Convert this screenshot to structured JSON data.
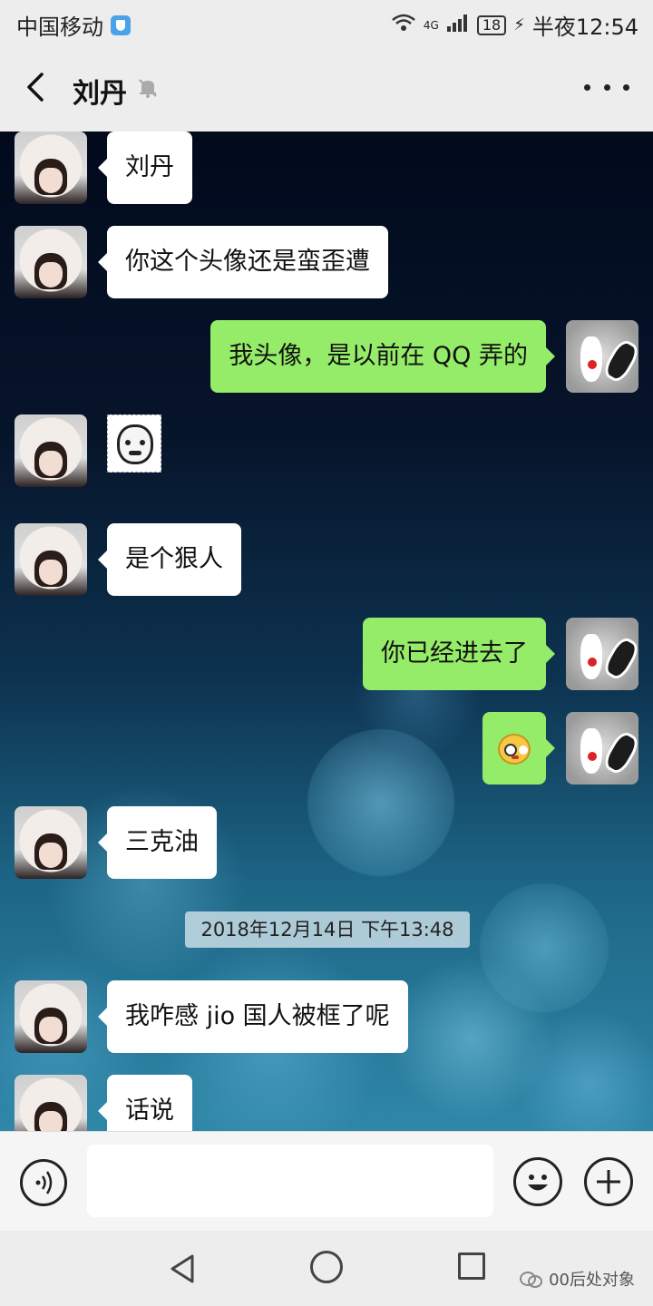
{
  "status_bar": {
    "carrier": "中国移动",
    "network": "4G",
    "battery": "18",
    "time": "半夜12:54"
  },
  "header": {
    "title": "刘丹",
    "back_icon": "back-arrow-icon",
    "mute_icon": "bell-muted-icon",
    "more_icon": "more-dots-icon"
  },
  "messages": [
    {
      "side": "left",
      "type": "text",
      "text": "刘丹"
    },
    {
      "side": "left",
      "type": "text",
      "text": "你这个头像还是蛮歪遭"
    },
    {
      "side": "right",
      "type": "text",
      "text": "我头像，是以前在 QQ 弄的"
    },
    {
      "side": "left",
      "type": "sticker",
      "sticker": "meme-face-sticker"
    },
    {
      "side": "left",
      "type": "text",
      "text": "是个狠人"
    },
    {
      "side": "right",
      "type": "text",
      "text": "你已经进去了"
    },
    {
      "side": "right",
      "type": "emoji",
      "emoji": "blushing-emoji"
    },
    {
      "side": "left",
      "type": "text",
      "text": "三克油"
    },
    {
      "type": "timestamp",
      "text": "2018年12月14日 下午13:48"
    },
    {
      "side": "left",
      "type": "text",
      "text": "我咋感 jio 国人被框了呢"
    },
    {
      "side": "left",
      "type": "text",
      "text": "话说"
    }
  ],
  "input_bar": {
    "voice_icon": "voice-icon",
    "input_value": "",
    "emoji_icon": "emoji-icon",
    "plus_icon": "plus-icon"
  },
  "nav_bar": {
    "watermark": "00后处对象"
  },
  "colors": {
    "sent_bubble": "#95ec69",
    "received_bubble": "#ffffff",
    "bar_background": "#ededed"
  }
}
